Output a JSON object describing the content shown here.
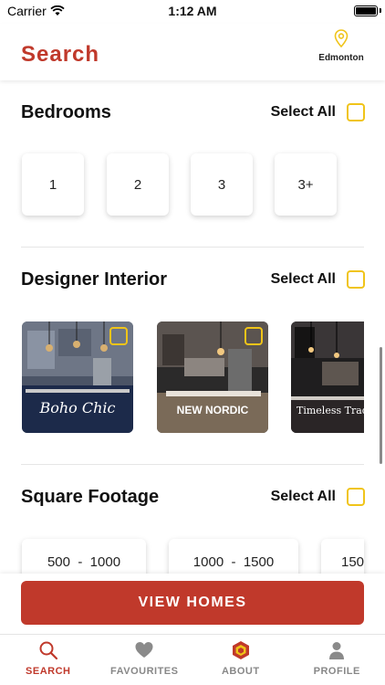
{
  "status": {
    "carrier": "Carrier",
    "time": "1:12 AM"
  },
  "header": {
    "title": "Search",
    "location": "Edmonton"
  },
  "bedrooms": {
    "title": "Bedrooms",
    "select_all": "Select All",
    "options": [
      "1",
      "2",
      "3",
      "3+"
    ]
  },
  "designer": {
    "title": "Designer Interior",
    "select_all": "Select All",
    "cards": [
      {
        "name": "Boho Chic"
      },
      {
        "name": "NEW NORDIC"
      },
      {
        "name": "Timeless Trad"
      }
    ]
  },
  "sqft": {
    "title": "Square Footage",
    "select_all": "Select All",
    "options": [
      "500  -  1000",
      "1000  -  1500",
      "150"
    ]
  },
  "cta": {
    "label": "VIEW HOMES"
  },
  "tabs": [
    {
      "label": "SEARCH",
      "icon": "search-icon",
      "active": true
    },
    {
      "label": "FAVOURITES",
      "icon": "heart-icon",
      "active": false
    },
    {
      "label": "ABOUT",
      "icon": "hexagon-logo-icon",
      "active": false
    },
    {
      "label": "PROFILE",
      "icon": "person-icon",
      "active": false
    }
  ],
  "colors": {
    "accent": "#c0392b",
    "checkbox": "#f0c419",
    "inactive": "#888888"
  }
}
